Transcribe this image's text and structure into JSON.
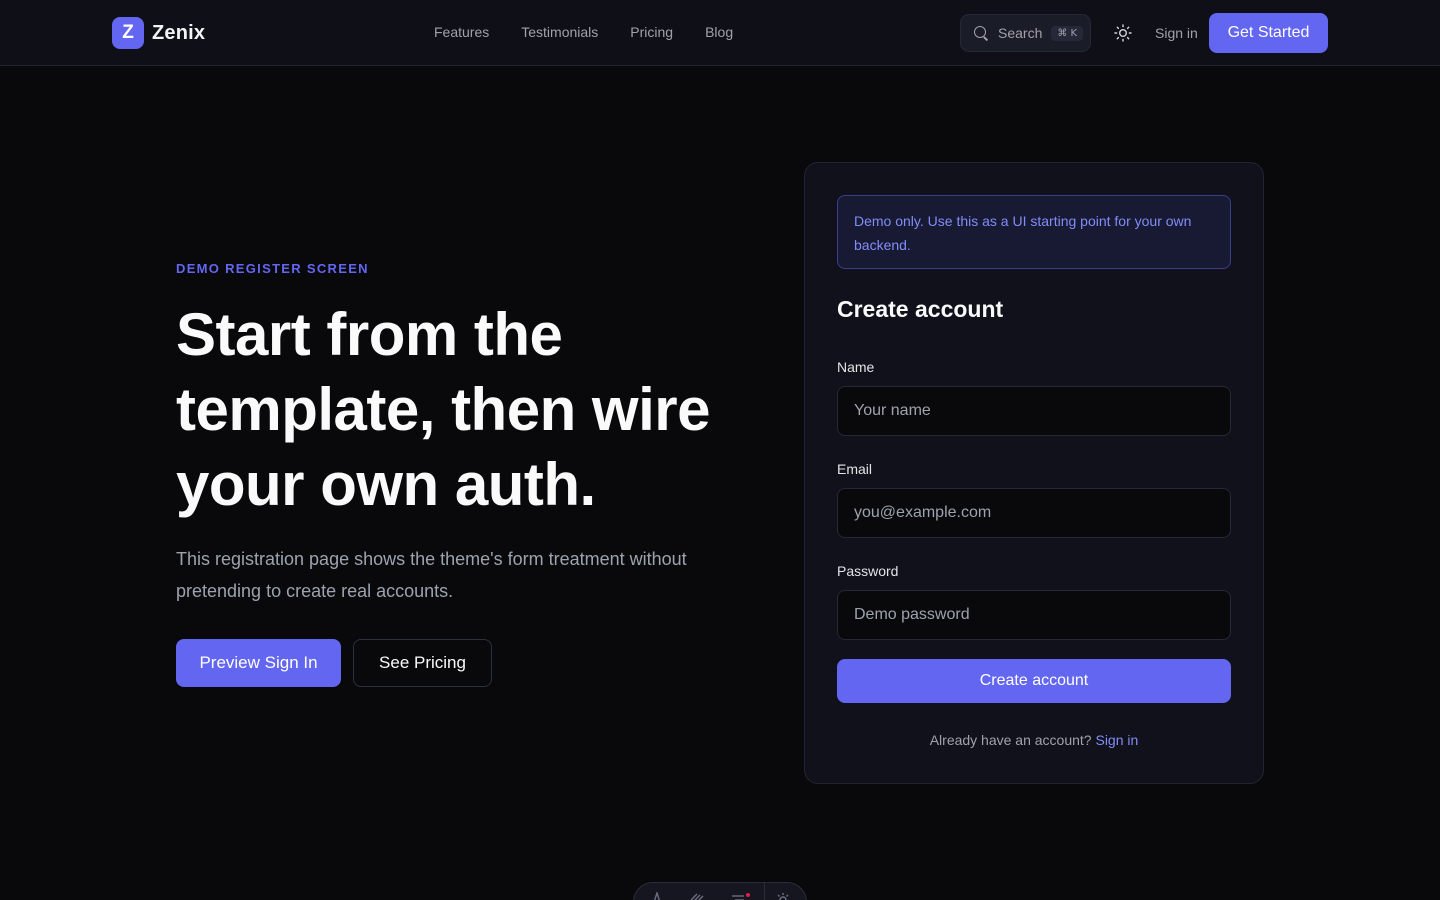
{
  "header": {
    "brand_initial": "Z",
    "brand_name": "Zenix",
    "nav": [
      "Features",
      "Testimonials",
      "Pricing",
      "Blog"
    ],
    "search_label": "Search",
    "search_shortcut": "⌘ K",
    "sign_in": "Sign in",
    "cta": "Get Started"
  },
  "hero": {
    "eyebrow": "DEMO REGISTER SCREEN",
    "title": "Start from the template, then wire your own auth.",
    "description": "This registration page shows the theme's form treatment without pretending to create real accounts.",
    "primary_button": "Preview Sign In",
    "secondary_button": "See Pricing"
  },
  "form": {
    "notice": "Demo only. Use this as a UI starting point for your own backend.",
    "title": "Create account",
    "name_label": "Name",
    "name_placeholder": "Your name",
    "email_label": "Email",
    "email_placeholder": "you@example.com",
    "password_label": "Password",
    "password_placeholder": "Demo password",
    "submit": "Create account",
    "footer_prompt": "Already have an account?",
    "footer_link": "Sign in"
  },
  "colors": {
    "accent": "#6366f1",
    "background": "#09090b",
    "card": "#10111a"
  },
  "icons": [
    "search-icon",
    "sun-icon"
  ]
}
